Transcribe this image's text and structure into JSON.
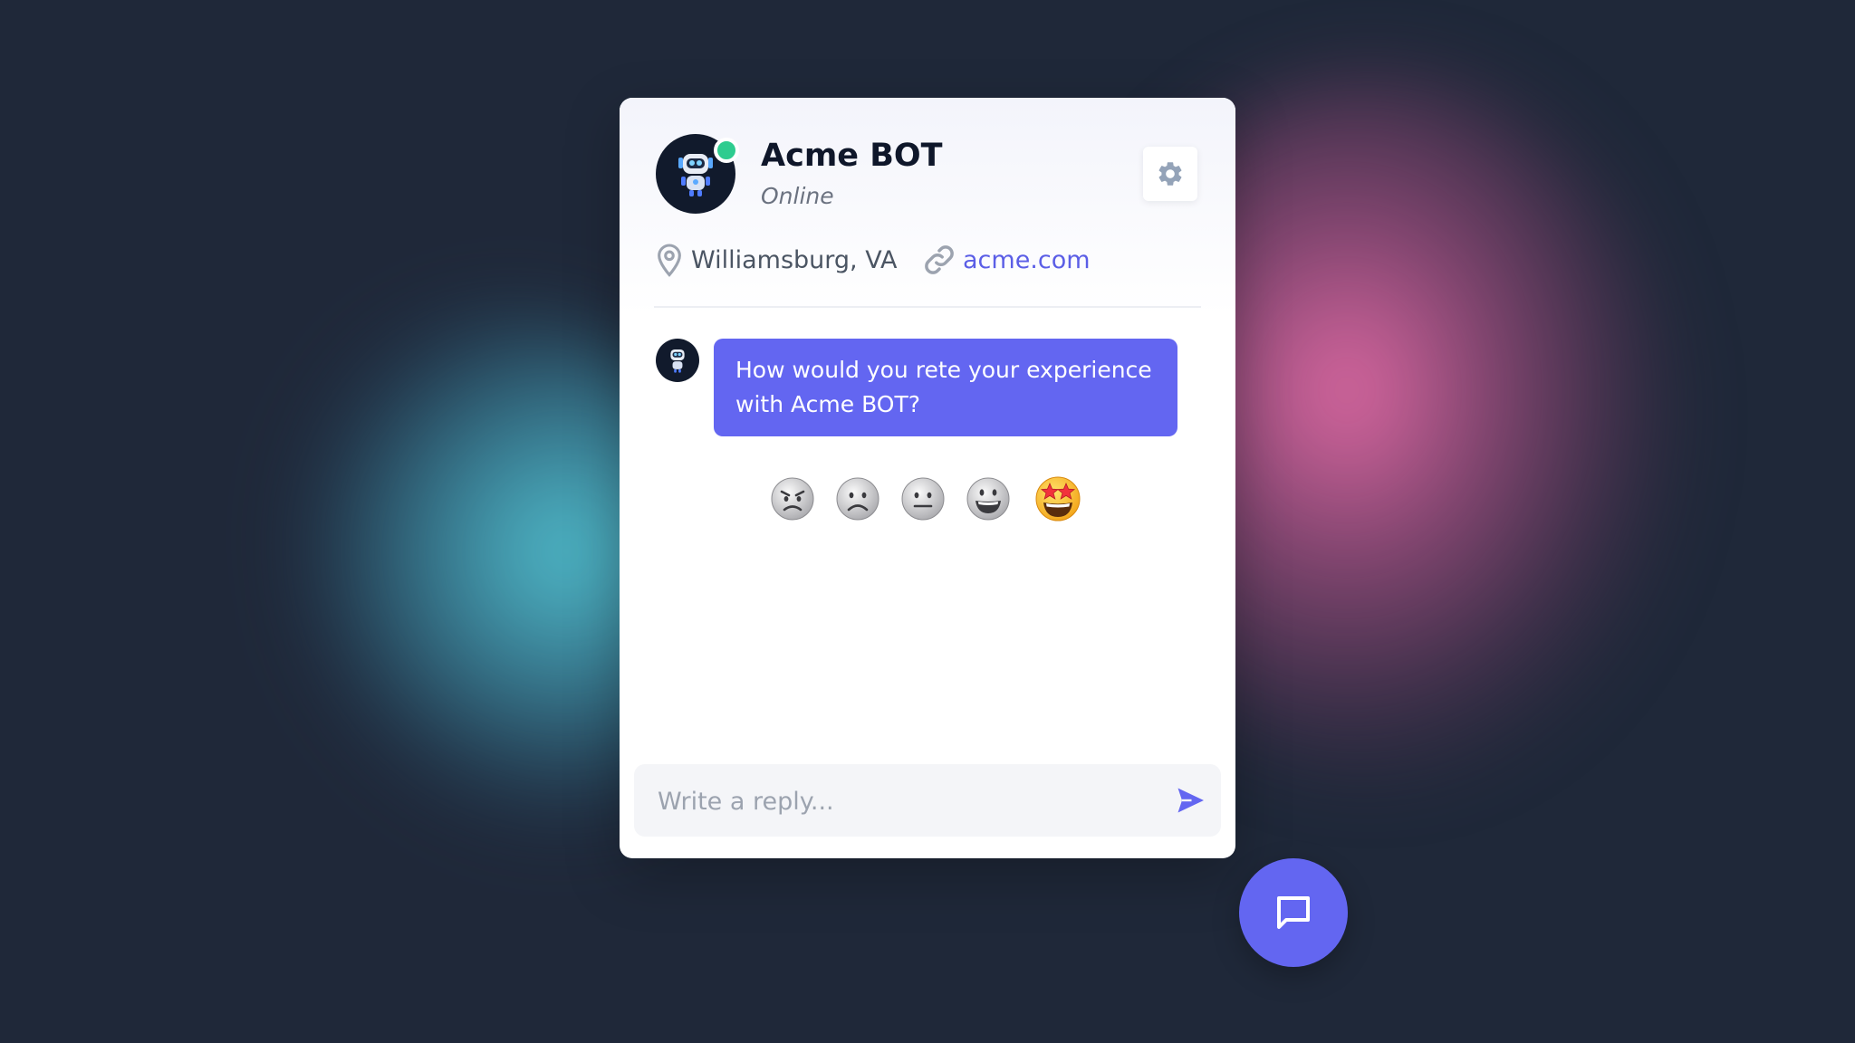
{
  "bot": {
    "name": "Acme BOT",
    "status": "Online",
    "location": "Williamsburg, VA",
    "website": "acme.com",
    "avatar_icon": "robot-avatar-icon",
    "status_color": "#2ecc8f"
  },
  "chat": {
    "messages": [
      {
        "sender": "bot",
        "text": "How would you rete your experience with Acme BOT?"
      }
    ],
    "rating_options": [
      {
        "icon": "angry-face-icon",
        "glyph": "😠"
      },
      {
        "icon": "frowning-face-icon",
        "glyph": "☹️"
      },
      {
        "icon": "neutral-face-icon",
        "glyph": "😐"
      },
      {
        "icon": "grinning-face-icon",
        "glyph": "😃"
      },
      {
        "icon": "star-struck-face-icon",
        "glyph": "🤩"
      }
    ]
  },
  "reply": {
    "placeholder": "Write a reply..."
  },
  "colors": {
    "accent": "#6366f1",
    "background": "#1f2839",
    "link": "#5b5ee6"
  }
}
